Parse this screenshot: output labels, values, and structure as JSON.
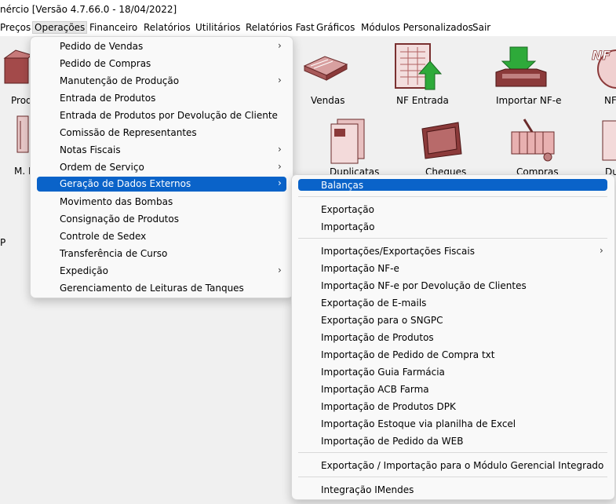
{
  "title": "nércio [Versão 4.7.66.0 - 18/04/2022]",
  "menubar": [
    "Preços",
    "Operações",
    "Financeiro",
    "Relatórios",
    "Utilitários",
    "Relatórios Fast",
    "Gráficos",
    "Módulos Personalizados",
    "Sair"
  ],
  "desktop": {
    "left_labels": [
      "Prod",
      "M. F",
      "P"
    ],
    "icons": [
      "Vendas",
      "NF Entrada",
      "Importar NF-e",
      "NF",
      "Duplicatas",
      "Cheques",
      "Compras",
      "Du"
    ]
  },
  "operacoes_menu": [
    "Pedido de Vendas",
    "Pedido de Compras",
    "Manutenção de Produção",
    "Entrada de Produtos",
    "Entrada de Produtos por Devolução de Cliente",
    "Comissão de Representantes",
    "Notas Fiscais",
    "Ordem de Serviço",
    "Geração de Dados Externos",
    "Movimento das Bombas",
    "Consignação de Produtos",
    "Controle de Sedex",
    "Transferência de Curso",
    "Expedição",
    "Gerenciamento de Leituras de Tanques"
  ],
  "submenu": [
    "Balanças",
    "Exportação",
    "Importação",
    "Importações/Exportações Fiscais",
    "Importação NF-e",
    "Importação NF-e por Devolução de Clientes",
    "Exportação de E-mails",
    "Exportação para o SNGPC",
    "Importação de Produtos",
    "Importação de Pedido de Compra txt",
    "Importação Guia Farmácia",
    "Importação ACB Farma",
    "Importação de Produtos DPK",
    "Importação Estoque via planilha de Excel",
    "Importação de Pedido da WEB",
    "Exportação / Importação para o Módulo Gerencial Integrado",
    "Integração IMendes"
  ],
  "colors": {
    "highlight": "#0a63c9",
    "icon_maroon": "#8b3a3a",
    "icon_green": "#2eaa3a"
  }
}
